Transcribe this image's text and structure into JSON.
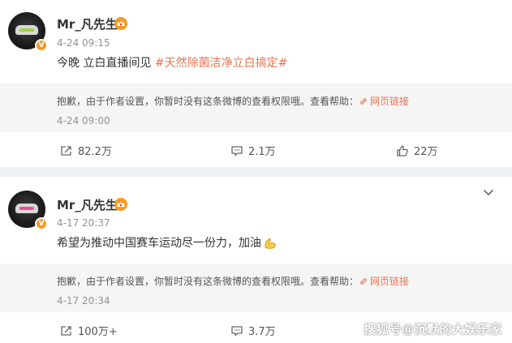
{
  "posts": [
    {
      "username": "Mr_凡先生",
      "time": "4-24 09:15",
      "text_plain": "今晚 立白直播间见 ",
      "hashtag": "#天然除菌洁净立白搞定#",
      "notice_prefix": "抱歉，由于作者设置，你暂时没有这条微博的查看权限哦。查看帮助：",
      "notice_link": "网页链接",
      "notice_time": "4-24 09:00",
      "reposts": "82.2万",
      "comments": "2.1万",
      "likes": "22万"
    },
    {
      "username": "Mr_凡先生",
      "time": "4-17 20:37",
      "text_plain": "希望为推动中国赛车运动尽一份力，加油",
      "notice_prefix": "抱歉，由于作者设置，你暂时没有这条微博的查看权限哦。查看帮助：",
      "notice_link": "网页链接",
      "notice_time": "4-17 20:34",
      "reposts": "100万+",
      "comments": "3.7万"
    }
  ],
  "watermark": "搜狐号@沉默的大娱乐家",
  "colors": {
    "accent": "#eb7350",
    "vip_orange": "#f59a23",
    "muted": "#939393"
  }
}
